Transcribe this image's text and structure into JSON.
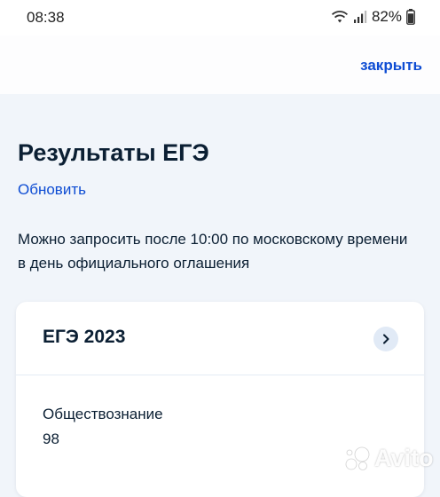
{
  "status_bar": {
    "time": "08:38",
    "battery_percent": "82%",
    "icons": [
      "wifi-icon",
      "cellular-signal-icon",
      "battery-icon"
    ]
  },
  "header": {
    "close_label": "закрыть"
  },
  "page": {
    "title": "Результаты ЕГЭ",
    "refresh_label": "Обновить",
    "info_text": "Можно запросить после 10:00 по московскому времени в день официального оглашения"
  },
  "card": {
    "title": "ЕГЭ 2023",
    "subject": "Обществознание",
    "score": "98"
  },
  "watermark": {
    "text": "Avito"
  },
  "colors": {
    "link": "#0d4cd3",
    "text": "#0b1f33",
    "background": "#f1f5fa",
    "chevron_bg": "#e1eaf6"
  }
}
